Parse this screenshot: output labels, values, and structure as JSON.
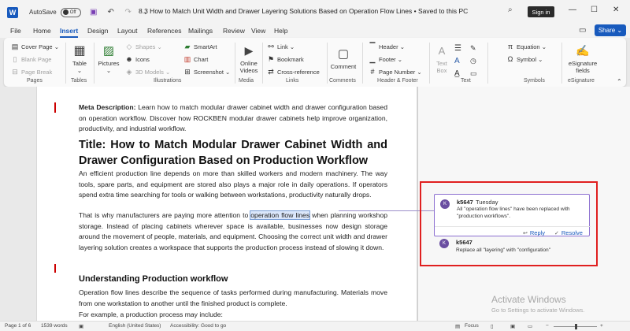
{
  "titlebar": {
    "logo": "W",
    "autosave_label": "AutoSave",
    "autosave_state": "Off",
    "document_title": "8.3 How to Match Unit Width and Drawer Layering Solutions Based on Operation Flow Lines  •  Saved to this PC",
    "signin": "Sign in"
  },
  "menu": {
    "tabs": [
      "File",
      "Home",
      "Insert",
      "Design",
      "Layout",
      "References",
      "Mailings",
      "Review",
      "View",
      "Help"
    ],
    "active": "Insert",
    "share": "Share"
  },
  "ribbon": {
    "pages": {
      "cover_page": "Cover Page",
      "blank_page": "Blank Page",
      "page_break": "Page Break",
      "label": "Pages"
    },
    "tables": {
      "table": "Table",
      "label": "Tables"
    },
    "illustrations": {
      "pictures": "Pictures",
      "shapes": "Shapes",
      "icons": "Icons",
      "models3d": "3D Models",
      "smartart": "SmartArt",
      "chart": "Chart",
      "screenshot": "Screenshot",
      "label": "Illustrations"
    },
    "media": {
      "online_videos": "Online Videos",
      "label": "Media"
    },
    "links": {
      "link": "Link",
      "bookmark": "Bookmark",
      "cross_reference": "Cross-reference",
      "label": "Links"
    },
    "comments": {
      "comment": "Comment",
      "label": "Comments"
    },
    "header_footer": {
      "header": "Header",
      "footer": "Footer",
      "page_number": "Page Number",
      "label": "Header & Footer"
    },
    "text": {
      "text_box": "Text Box",
      "label": "Text"
    },
    "symbols": {
      "equation": "Equation",
      "symbol": "Symbol",
      "label": "Symbols"
    },
    "esignature": {
      "fields": "eSignature fields",
      "label": "eSignature"
    }
  },
  "document": {
    "meta_label": "Meta Description:",
    "meta_text": " Learn how to match modular drawer cabinet width and drawer configuration based on operation workflow. Discover how ROCKBEN modular drawer cabinets help improve organization, productivity, and industrial workflow.",
    "title": "Title: How to Match Modular Drawer Cabinet Width and Drawer Configuration Based on Production Workflow",
    "p1": "An efficient production line depends on more than skilled workers and modern machinery. The way tools, spare parts, and equipment are stored also plays a major role in daily operations. If operators spend extra time searching for tools or walking between workstations, productivity naturally drops.",
    "p2_before": "That is why manufacturers are paying more attention to ",
    "p2_highlight": "operation flow lines",
    "p2_after": " when planning workshop storage. Instead of placing cabinets wherever space is available, businesses now design storage around the movement of people, materials, and equipment. Choosing the correct unit width and drawer layering solution creates a workspace that supports the production process instead of slowing it down.",
    "h2": "Understanding Production workflow",
    "p3": "Operation flow lines describe the sequence of tasks performed during manufacturing. Materials move from one workstation to another until the finished product is complete.",
    "p4": "For example, a production process may include:"
  },
  "comments": [
    {
      "initial": "K",
      "author": "k5647",
      "date": "Tuesday",
      "text": "All \"operation flow lines\" have been replaced with \"production workflows\".",
      "reply": "Reply",
      "resolve": "Resolve"
    },
    {
      "initial": "K",
      "author": "k5647",
      "text": "Replace all \"layering\" with \"configuration\""
    }
  ],
  "watermark": {
    "title": "Activate Windows",
    "subtitle": "Go to Settings to activate Windows."
  },
  "status": {
    "page": "Page 1 of 6",
    "words": "1539 words",
    "language": "English (United States)",
    "accessibility": "Accessibility: Good to go",
    "focus": "Focus"
  }
}
